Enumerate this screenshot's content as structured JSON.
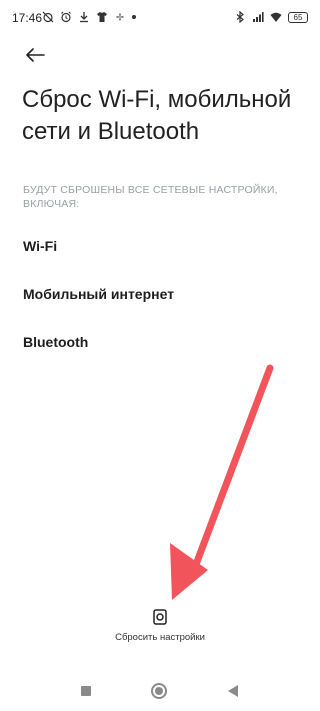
{
  "status_bar": {
    "time": "17:46",
    "battery": "65",
    "icons_left": [
      "alarm-off-icon",
      "alarm-icon",
      "download-icon",
      "shirt-icon",
      "fan-icon",
      "dot-icon"
    ],
    "icons_right": [
      "bluetooth-icon",
      "signal-icon",
      "wifi-icon",
      "battery-icon"
    ]
  },
  "header": {
    "back_icon": "arrow-left-icon",
    "title": "Сброс Wi-Fi, мобильной сети и Bluetooth"
  },
  "note": "БУДУТ СБРОШЕНЫ ВСЕ СЕТЕВЫЕ НАСТРОЙКИ, ВКЛЮЧАЯ:",
  "items": [
    {
      "label": "Wi-Fi"
    },
    {
      "label": "Мобильный интернет"
    },
    {
      "label": "Bluetooth"
    }
  ],
  "reset": {
    "icon": "reset-settings-icon",
    "label": "Сбросить настройки"
  },
  "annotation": {
    "color": "#f2545b"
  },
  "nav_bar": {
    "icons": [
      "recents-square-icon",
      "home-circle-icon",
      "back-triangle-icon"
    ],
    "color": "#8a8a8a"
  }
}
